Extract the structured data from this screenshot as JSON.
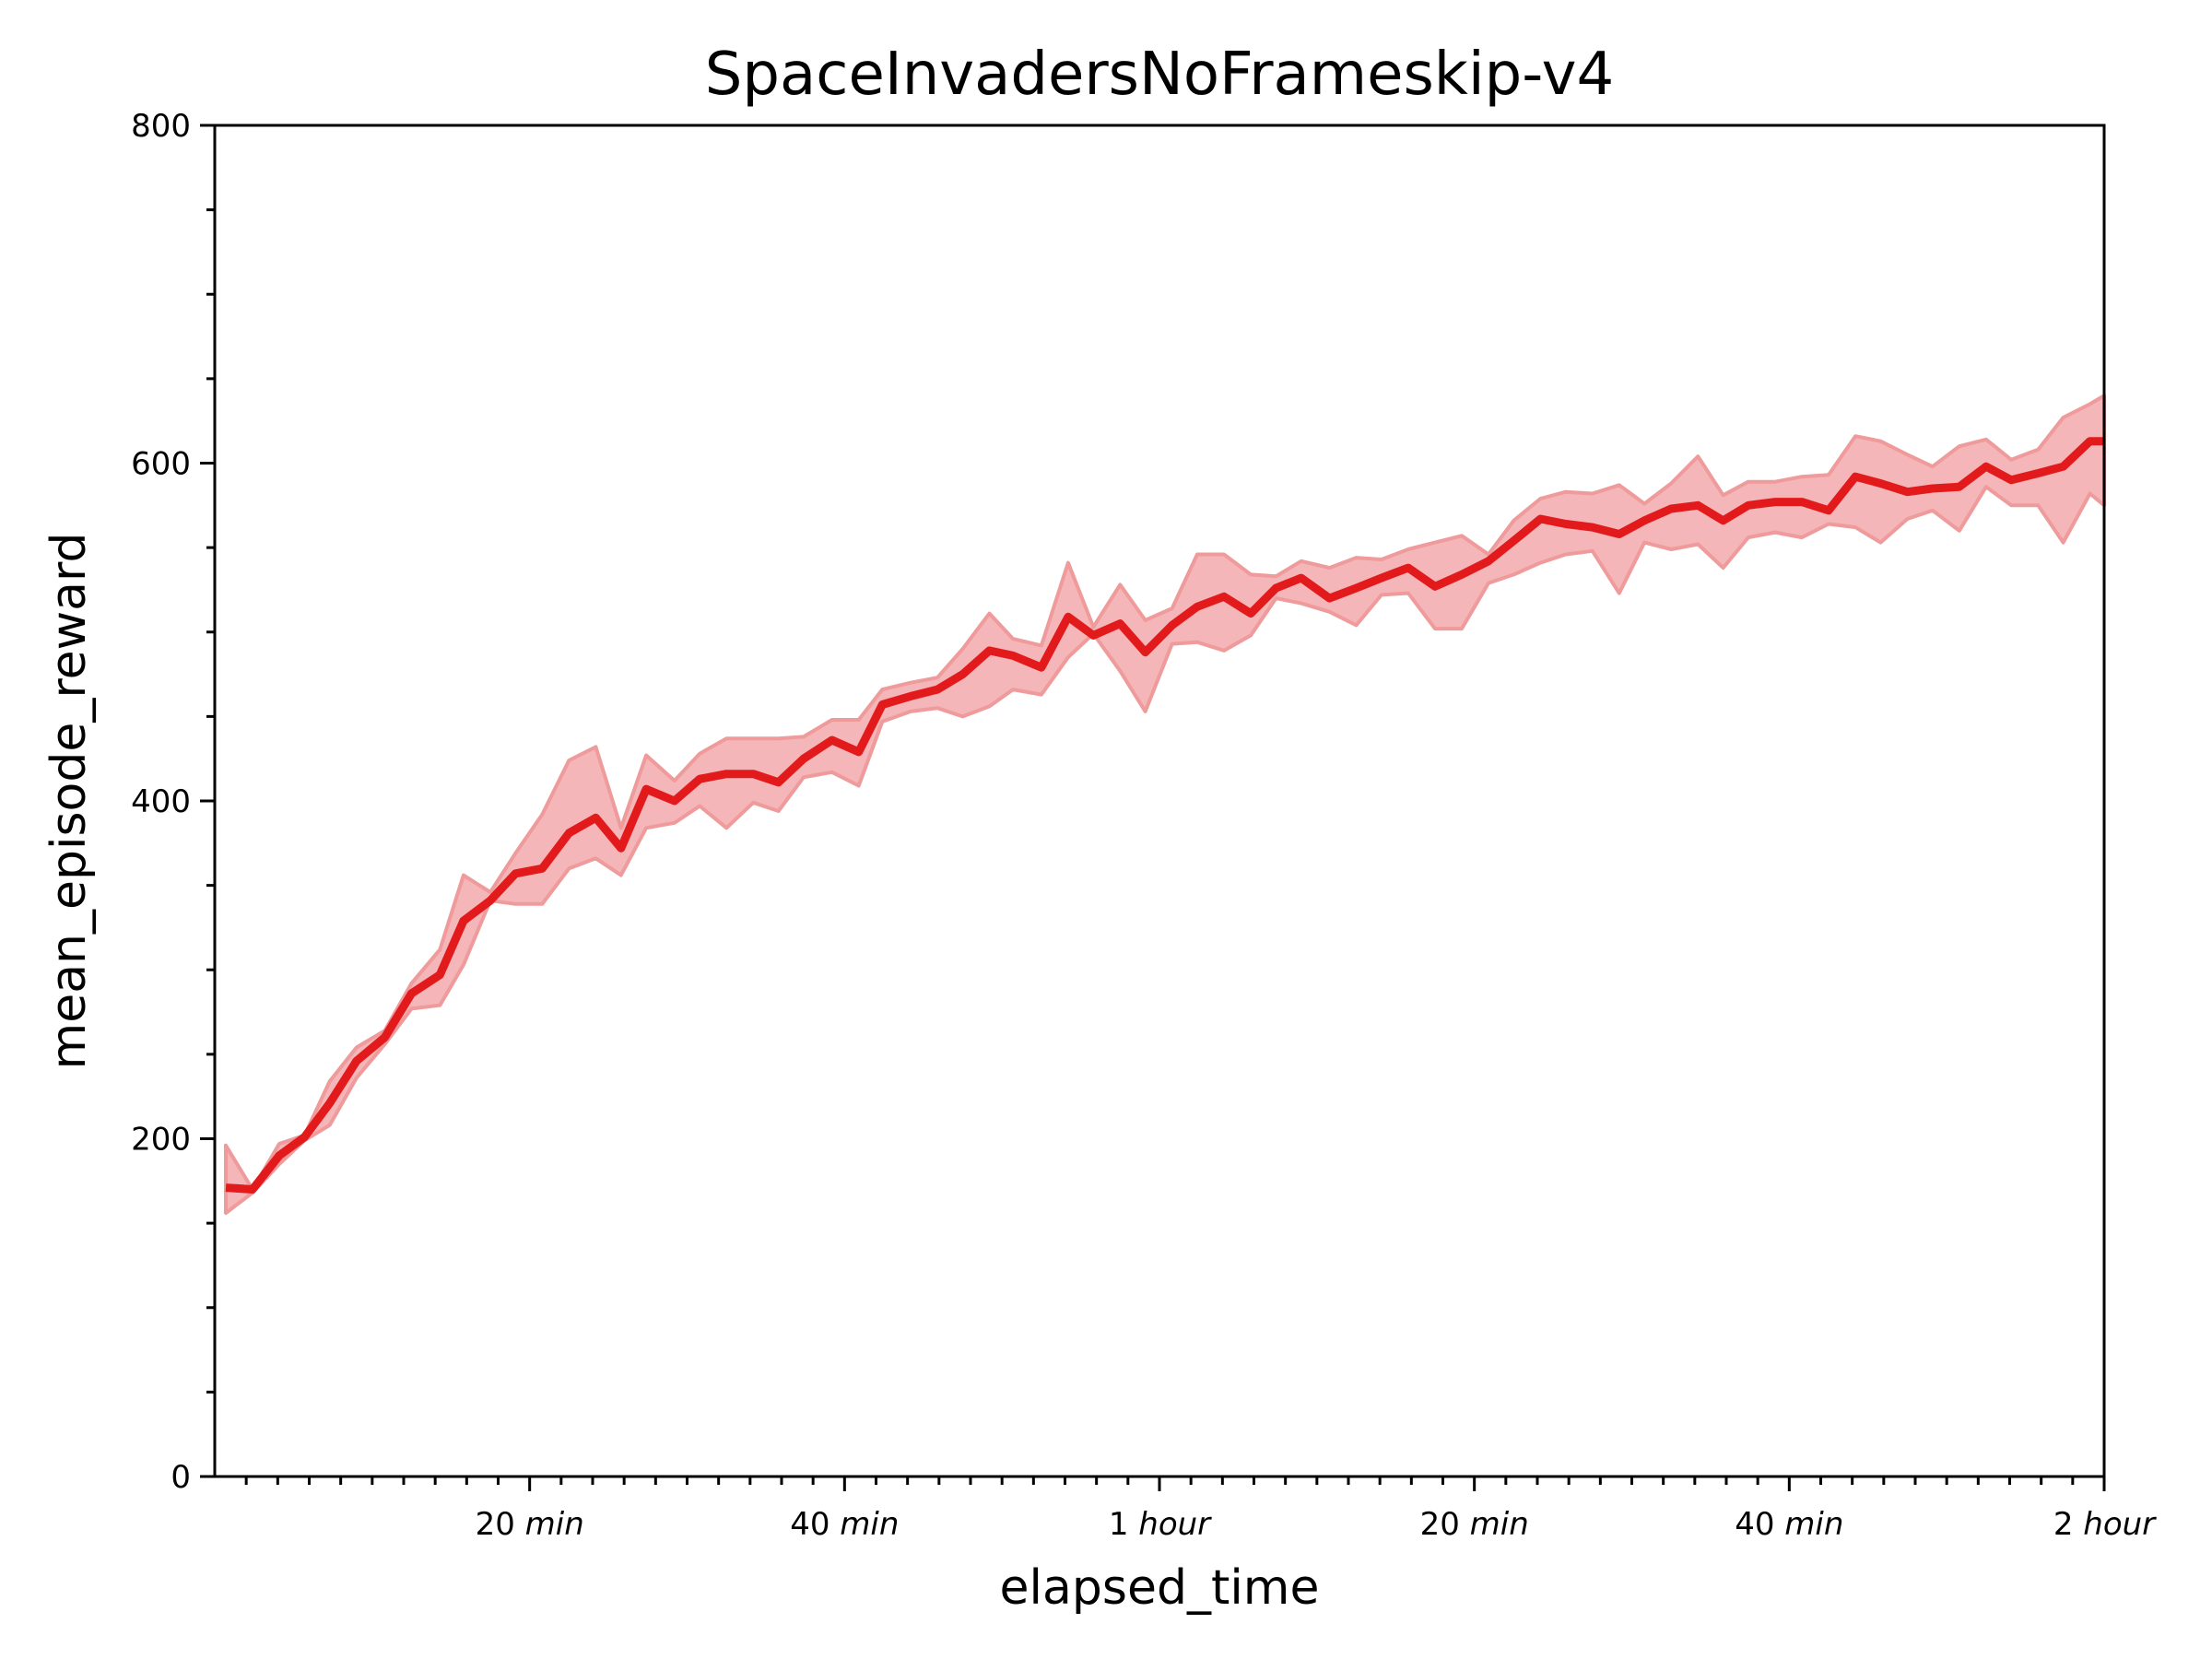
{
  "chart_data": {
    "type": "line",
    "title": "SpaceInvadersNoFrameskip-v4",
    "xlabel": "elapsed_time",
    "ylabel": "mean_episode_reward",
    "xunit": "minutes",
    "xlim": [
      0,
      120
    ],
    "ylim": [
      0,
      800
    ],
    "grid": false,
    "legend": "none",
    "yticks": [
      0,
      200,
      400,
      600,
      800
    ],
    "yticklabels": [
      "0",
      "200",
      "400",
      "600",
      "800"
    ],
    "yminor_step": 50,
    "xticks": [
      {
        "value": 20,
        "num": "20",
        "unit": "min"
      },
      {
        "value": 40,
        "num": "40",
        "unit": "min"
      },
      {
        "value": 60,
        "num": "1",
        "unit": "hour"
      },
      {
        "value": 80,
        "num": "20",
        "unit": "min"
      },
      {
        "value": 100,
        "num": "40",
        "unit": "min"
      },
      {
        "value": 120,
        "num": "2",
        "unit": "hour"
      }
    ],
    "xminor_step": 2,
    "colors": {
      "line": "#e31a1c",
      "band_fill": "#f4b6b8",
      "band_edge": "#ef9a9b"
    },
    "x": [
      0.7,
      2.4,
      4.1,
      5.7,
      7.3,
      9.0,
      10.8,
      12.5,
      14.3,
      15.8,
      17.5,
      19.1,
      20.8,
      22.5,
      24.2,
      25.8,
      27.4,
      29.2,
      30.8,
      32.5,
      34.2,
      35.8,
      37.4,
      39.2,
      40.9,
      42.4,
      44.2,
      45.9,
      47.5,
      49.2,
      50.7,
      52.5,
      54.2,
      55.8,
      57.5,
      59.1,
      60.8,
      62.4,
      64.1,
      65.8,
      67.4,
      69.0,
      70.8,
      72.5,
      74.1,
      75.8,
      77.5,
      79.2,
      80.9,
      82.5,
      84.2,
      85.8,
      87.5,
      89.2,
      90.8,
      92.5,
      94.2,
      95.8,
      97.4,
      99.1,
      100.8,
      102.5,
      104.2,
      105.8,
      107.5,
      109.1,
      110.8,
      112.5,
      114.1,
      115.8,
      117.4,
      119.1,
      120.0
    ],
    "series": [
      {
        "name": "mean",
        "values": [
          171,
          170,
          190,
          201,
          221,
          246,
          260,
          286,
          297,
          329,
          341,
          357,
          360,
          381,
          390,
          372,
          407,
          400,
          413,
          416,
          416,
          411,
          425,
          436,
          429,
          457,
          462,
          466,
          475,
          489,
          486,
          479,
          509,
          498,
          505,
          488,
          504,
          515,
          521,
          511,
          526,
          532,
          520,
          526,
          532,
          538,
          527,
          534,
          542,
          554,
          567,
          564,
          562,
          558,
          566,
          573,
          575,
          566,
          575,
          577,
          577,
          572,
          592,
          588,
          583,
          585,
          586,
          598,
          590,
          594,
          598,
          613,
          613
        ]
      },
      {
        "name": "upper",
        "values": [
          196,
          170,
          197,
          202,
          234,
          254,
          264,
          292,
          312,
          356,
          346,
          369,
          392,
          424,
          432,
          384,
          427,
          412,
          428,
          437,
          437,
          437,
          438,
          448,
          448,
          466,
          470,
          473,
          490,
          511,
          496,
          492,
          541,
          503,
          528,
          507,
          514,
          546,
          546,
          534,
          533,
          542,
          538,
          544,
          543,
          549,
          553,
          557,
          546,
          566,
          579,
          583,
          582,
          587,
          576,
          588,
          604,
          581,
          589,
          589,
          592,
          593,
          616,
          613,
          605,
          598,
          610,
          614,
          602,
          608,
          627,
          635,
          640
        ]
      },
      {
        "name": "lower",
        "values": [
          156,
          168,
          185,
          199,
          208,
          236,
          256,
          277,
          279,
          303,
          341,
          339,
          339,
          360,
          366,
          356,
          384,
          387,
          397,
          384,
          399,
          394,
          414,
          417,
          409,
          447,
          453,
          455,
          450,
          456,
          466,
          463,
          485,
          499,
          477,
          453,
          493,
          494,
          489,
          498,
          520,
          517,
          512,
          504,
          522,
          523,
          502,
          502,
          529,
          534,
          541,
          546,
          548,
          523,
          553,
          549,
          552,
          538,
          556,
          559,
          556,
          564,
          562,
          553,
          567,
          572,
          560,
          586,
          575,
          575,
          553,
          582,
          575
        ]
      }
    ]
  }
}
